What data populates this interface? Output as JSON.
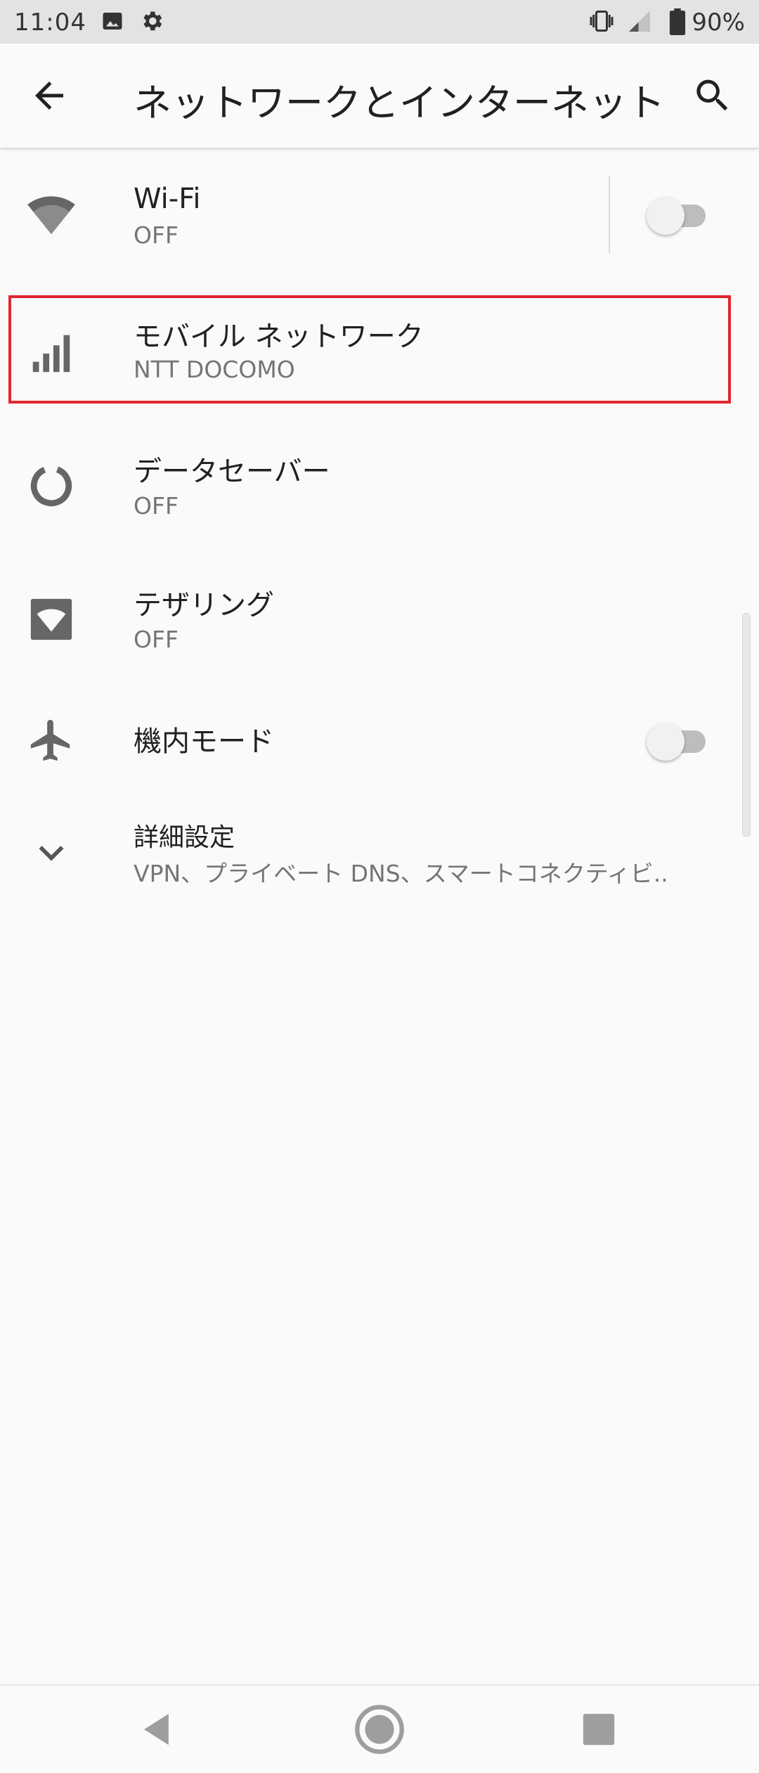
{
  "status_bar": {
    "time": "11:04",
    "battery": "90%",
    "icons": [
      "image-icon",
      "gear-icon",
      "vibrate-icon",
      "signal-icon",
      "battery-icon"
    ]
  },
  "app_bar": {
    "title": "ネットワークとインターネット",
    "icons": [
      "back-arrow-icon",
      "search-icon"
    ]
  },
  "settings": [
    {
      "title": "Wi-Fi",
      "subtitle": "OFF",
      "icon": "wifi-icon",
      "toggle": "off"
    },
    {
      "title": "モバイル ネットワーク",
      "subtitle": "NTT DOCOMO",
      "icon": "signal-bars-icon",
      "highlighted": true
    },
    {
      "title": "データセーバー",
      "subtitle": "OFF",
      "icon": "data-saver-icon"
    },
    {
      "title": "テザリング",
      "subtitle": "OFF",
      "icon": "hotspot-icon"
    },
    {
      "title": "機内モード",
      "icon": "airplane-icon",
      "toggle": "off"
    },
    {
      "title": "詳細設定",
      "subtitle": "VPN、プライベート DNS、スマートコネクティビ..",
      "icon": "chevron-down-icon"
    }
  ],
  "nav_bar": {
    "icons": [
      "back-icon",
      "home-icon",
      "recents-icon"
    ]
  },
  "colors": {
    "highlight_border": "#e0262e",
    "icon_gray": "#666666"
  }
}
